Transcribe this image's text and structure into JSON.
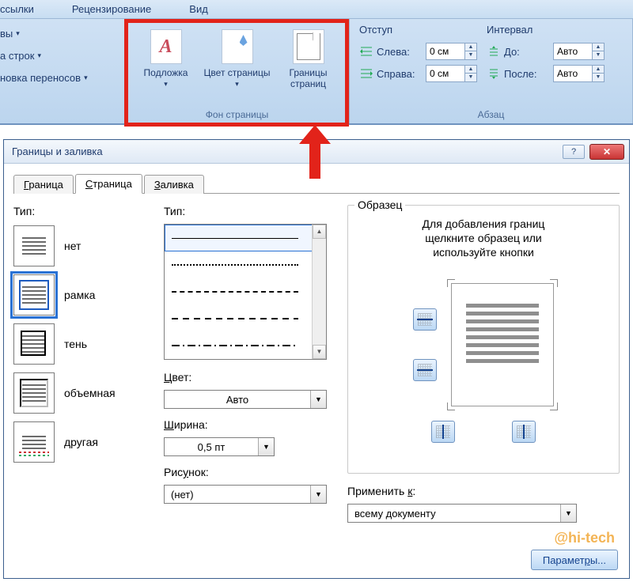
{
  "ribbon": {
    "tabs": [
      "ссылки",
      "Рецензирование",
      "Вид"
    ],
    "left_group": {
      "row1": "вы",
      "row2": "а строк",
      "row3": "новка переносов",
      "dd": "▾"
    },
    "page_bg_group": {
      "watermark": "Подложка",
      "page_color": "Цвет страницы",
      "page_borders": "Границы страниц",
      "dd": "▾",
      "label": "Фон страницы"
    },
    "paragraph_group": {
      "indent_title": "Отступ",
      "spacing_title": "Интервал",
      "left_label": "Слева:",
      "right_label": "Справа:",
      "before_label": "До:",
      "after_label": "После:",
      "left_val": "0 см",
      "right_val": "0 см",
      "before_val": "Авто",
      "after_val": "Авто",
      "label": "Абзац"
    }
  },
  "dialog": {
    "title": "Границы и заливка",
    "help": "?",
    "close": "✕",
    "tabs": {
      "border": "Граница",
      "page": "Страница",
      "shading": "Заливка"
    },
    "setting": {
      "label": "Тип:",
      "none": "нет",
      "box": "рамка",
      "shadow": "тень",
      "threeD": "объемная",
      "custom": "другая"
    },
    "style": {
      "label": "Тип:",
      "color_label": "Цвет:",
      "color_value": "Авто",
      "width_label": "Ширина:",
      "width_value": "0,5 пт",
      "art_label": "Рисунок:",
      "art_value": "(нет)"
    },
    "preview": {
      "legend": "Образец",
      "hint1": "Для добавления границ",
      "hint2": "щелкните образец или",
      "hint3": "используйте кнопки",
      "apply_label": "Применить к:",
      "apply_value": "всему документу",
      "options_btn": "Параметры..."
    }
  },
  "watermark": "@hi-tech"
}
